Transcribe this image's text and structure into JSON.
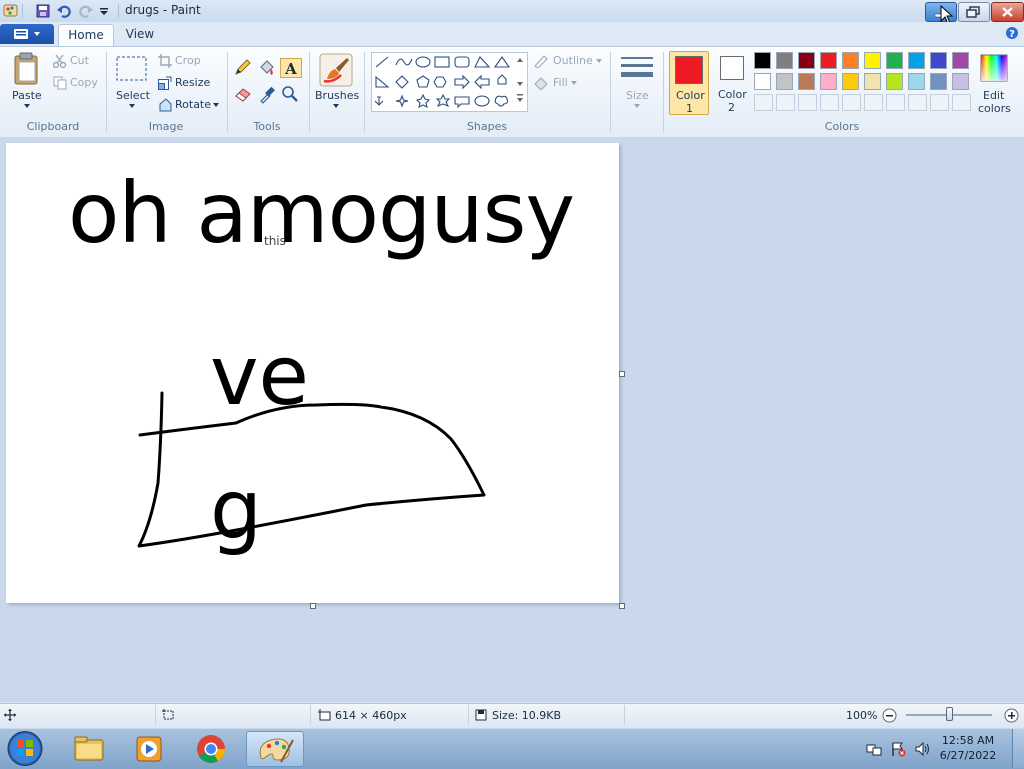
{
  "window": {
    "title": "drugs - Paint",
    "minimize_icon": "minimize-icon",
    "maximize_icon": "restore-icon",
    "close_icon": "close-icon"
  },
  "tabs": {
    "file_label": "",
    "home": "Home",
    "view": "View"
  },
  "clipboard": {
    "paste": "Paste",
    "cut": "Cut",
    "copy": "Copy",
    "group": "Clipboard"
  },
  "image": {
    "select": "Select",
    "crop": "Crop",
    "resize": "Resize",
    "rotate": "Rotate",
    "group": "Image"
  },
  "tools": {
    "group": "Tools"
  },
  "brushes": {
    "label": "Brushes"
  },
  "shapes": {
    "outline": "Outline",
    "fill": "Fill",
    "group": "Shapes"
  },
  "size": {
    "label": "Size"
  },
  "colors": {
    "color1_label": "Color",
    "color1_num": "1",
    "color2_label": "Color",
    "color2_num": "2",
    "edit_label": "Edit",
    "edit_label2": "colors",
    "group": "Colors",
    "color1": "#ed1c24",
    "color2": "#ffffff",
    "row1": [
      "#000000",
      "#7f7f7f",
      "#880015",
      "#ed1c24",
      "#ff7f27",
      "#fff200",
      "#22b14c",
      "#00a2e8",
      "#3f48cc",
      "#a349a4"
    ],
    "row2": [
      "#ffffff",
      "#c3c3c3",
      "#b97a57",
      "#ffaec9",
      "#ffc90e",
      "#efe4b0",
      "#b5e61d",
      "#99d9ea",
      "#7092be",
      "#c8bfe7"
    ]
  },
  "canvas": {
    "text_line1": "oh amogusy",
    "text_small": "this",
    "text_ve": "ve",
    "text_g": "g"
  },
  "status": {
    "dimensions": "614 × 460px",
    "size": "Size: 10.9KB",
    "zoom": "100%"
  },
  "taskbar": {
    "time": "12:58 AM",
    "date": "6/27/2022"
  }
}
